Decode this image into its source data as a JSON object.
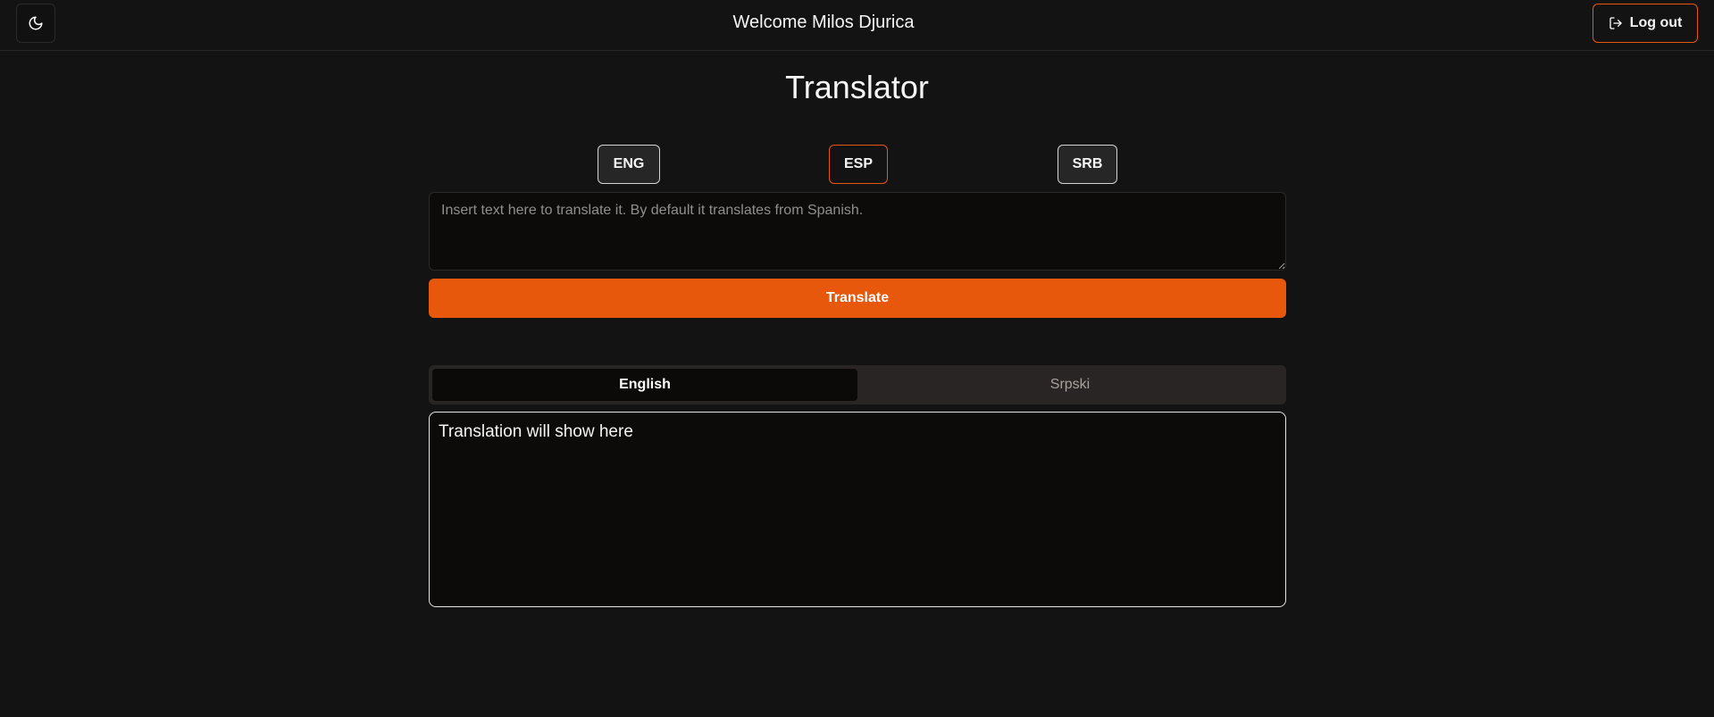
{
  "header": {
    "theme_toggle_icon": "moon-icon",
    "welcome_text": "Welcome Milos Djurica",
    "logout_label": "Log out",
    "logout_icon": "log-out-icon"
  },
  "main": {
    "title": "Translator",
    "languages": [
      {
        "label": "ENG",
        "selected": false
      },
      {
        "label": "ESP",
        "selected": true
      },
      {
        "label": "SRB",
        "selected": false
      }
    ],
    "input": {
      "value": "",
      "placeholder": "Insert text here to translate it. By default it translates from Spanish."
    },
    "translate_label": "Translate",
    "tabs": [
      {
        "label": "English",
        "active": true
      },
      {
        "label": "Srpski",
        "active": false
      }
    ],
    "output_text": "Translation will show here"
  },
  "colors": {
    "background": "#131313",
    "accent": "#e8580c",
    "text": "#f5f5f5",
    "muted": "#8f8f8f"
  }
}
